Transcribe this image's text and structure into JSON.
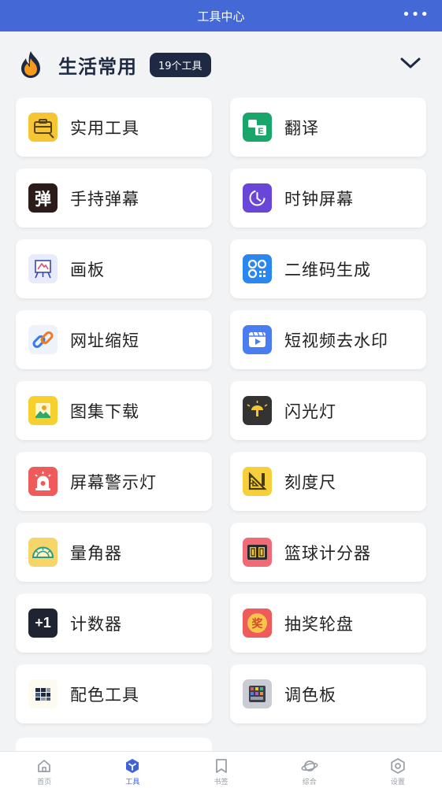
{
  "header": {
    "title": "工具中心",
    "more": "•••"
  },
  "section": {
    "title": "生活常用",
    "badge": "19个工具"
  },
  "tools": [
    {
      "label": "实用工具",
      "icon": "toolbox-icon",
      "color": "#f5c533"
    },
    {
      "label": "翻译",
      "icon": "translate-icon",
      "color": "#1aa66b"
    },
    {
      "label": "手持弹幕",
      "icon": "danmaku-icon",
      "color": "#2b1c1a",
      "glyph": "弹"
    },
    {
      "label": "时钟屏幕",
      "icon": "clock-icon",
      "color": "#6a46d8"
    },
    {
      "label": "画板",
      "icon": "drawing-board-icon",
      "color": "#e8ebfb"
    },
    {
      "label": "二维码生成",
      "icon": "qrcode-icon",
      "color": "#2a86f0"
    },
    {
      "label": "网址缩短",
      "icon": "link-icon",
      "color": "#eef3fb"
    },
    {
      "label": "短视频去水印",
      "icon": "video-icon",
      "color": "#4a7cf2"
    },
    {
      "label": "图集下载",
      "icon": "gallery-icon",
      "color": "#f6d02e"
    },
    {
      "label": "闪光灯",
      "icon": "flashlight-icon",
      "color": "#333333"
    },
    {
      "label": "屏幕警示灯",
      "icon": "alarm-light-icon",
      "color": "#ef5a5a"
    },
    {
      "label": "刻度尺",
      "icon": "ruler-icon",
      "color": "#f6cf3a"
    },
    {
      "label": "量角器",
      "icon": "protractor-icon",
      "color": "#f6d56a"
    },
    {
      "label": "篮球计分器",
      "icon": "scoreboard-icon",
      "color": "#f06a78"
    },
    {
      "label": "计数器",
      "icon": "counter-icon",
      "color": "#1f2430",
      "glyph": "+1"
    },
    {
      "label": "抽奖轮盘",
      "icon": "lottery-icon",
      "color": "#ef5a5a",
      "glyph": "奖"
    },
    {
      "label": "配色工具",
      "icon": "color-scheme-icon",
      "color": "#fdfaf0"
    },
    {
      "label": "调色板",
      "icon": "palette-icon",
      "color": "#c9ccd2"
    }
  ],
  "tabs": [
    {
      "label": "首页",
      "icon": "home-icon"
    },
    {
      "label": "工具",
      "icon": "tools-icon",
      "active": true
    },
    {
      "label": "书签",
      "icon": "bookmark-icon"
    },
    {
      "label": "综合",
      "icon": "planet-icon"
    },
    {
      "label": "设置",
      "icon": "settings-icon"
    }
  ],
  "colors": {
    "header": "#4468d6",
    "section_title": "#1e2a44",
    "active_tab": "#3f63d6"
  }
}
